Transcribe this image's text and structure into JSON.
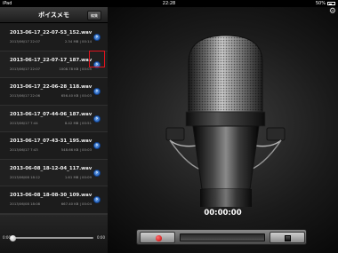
{
  "status_bar": {
    "device": "iPad",
    "time": "22:28",
    "battery": "50%"
  },
  "sidebar": {
    "title": "ボイスメモ",
    "edit_label": "編集",
    "files": [
      {
        "name": "2013-06-17_22-07-53_152.wav",
        "date": "2013/06/17 22:07",
        "meta": "2.34 MB | 00:14"
      },
      {
        "name": "2013-06-17_22-07-17_187.wav",
        "date": "2013/06/17 22:07",
        "meta": "1008.78 KB | 00:05"
      },
      {
        "name": "2013-06-17_22-06-28_118.wav",
        "date": "2013/06/17 22:06",
        "meta": "656.40 KB | 00:03"
      },
      {
        "name": "2013-06-17_07-44-06_187.wav",
        "date": "2013/06/17 7:44",
        "meta": "8.42 MB | 00:51"
      },
      {
        "name": "2013-06-17_07-43-31_195.wav",
        "date": "2013/06/17 7:43",
        "meta": "548.66 KB | 00:03"
      },
      {
        "name": "2013-06-08_18-12-04_117.wav",
        "date": "2013/06/08 18:12",
        "meta": "1.61 MB | 00:09"
      },
      {
        "name": "2013-06-08_18-08-30_109.wav",
        "date": "2013/06/08 18:08",
        "meta": "667.40 KB | 00:04"
      }
    ],
    "playback": {
      "start": "0:00",
      "end": "0:00",
      "position": 0
    }
  },
  "main": {
    "time_display": "00:00:00"
  },
  "colors": {
    "highlight": "#e0141e",
    "disclosure": "#2f6fd0",
    "record": "#d00000"
  },
  "icons": {
    "settings": "gear-icon",
    "disclosure": "chevron-right-circle-icon",
    "record": "record-icon",
    "stop": "stop-icon",
    "microphone": "microphone-icon"
  }
}
